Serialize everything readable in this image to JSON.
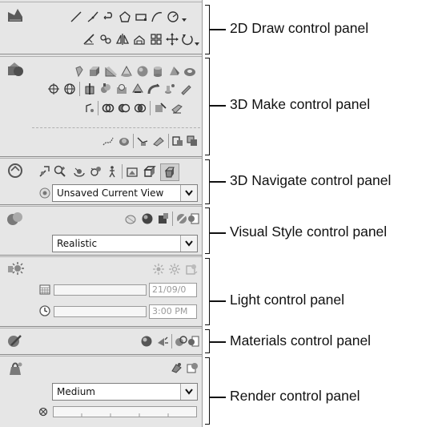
{
  "panels": {
    "draw": {
      "label": "2D Draw control panel"
    },
    "make": {
      "label": "3D Make control panel"
    },
    "navigate": {
      "label": "3D Navigate control panel",
      "view_combo": "Unsaved Current View"
    },
    "visual": {
      "label": "Visual Style control panel",
      "style_combo": "Realistic"
    },
    "light": {
      "label": "Light control panel",
      "date_value": "21/09/0",
      "time_value": "3:00 PM"
    },
    "materials": {
      "label": "Materials control panel"
    },
    "render": {
      "label": "Render control panel",
      "quality_combo": "Medium"
    }
  },
  "colors": {
    "panel_bg": "#e6e6e6",
    "icon_gray": "#555555",
    "icon_dark": "#222222"
  },
  "icons": [
    "line",
    "polyline",
    "arc",
    "polygon",
    "rectangle",
    "spline",
    "circle",
    "hatch",
    "revcloud",
    "mirror",
    "region",
    "array",
    "move",
    "rotate",
    "extrude",
    "box",
    "wedge",
    "cone",
    "sphere",
    "cylinder",
    "torus",
    "orbit",
    "pan",
    "zoom",
    "light",
    "sun",
    "material",
    "render"
  ]
}
